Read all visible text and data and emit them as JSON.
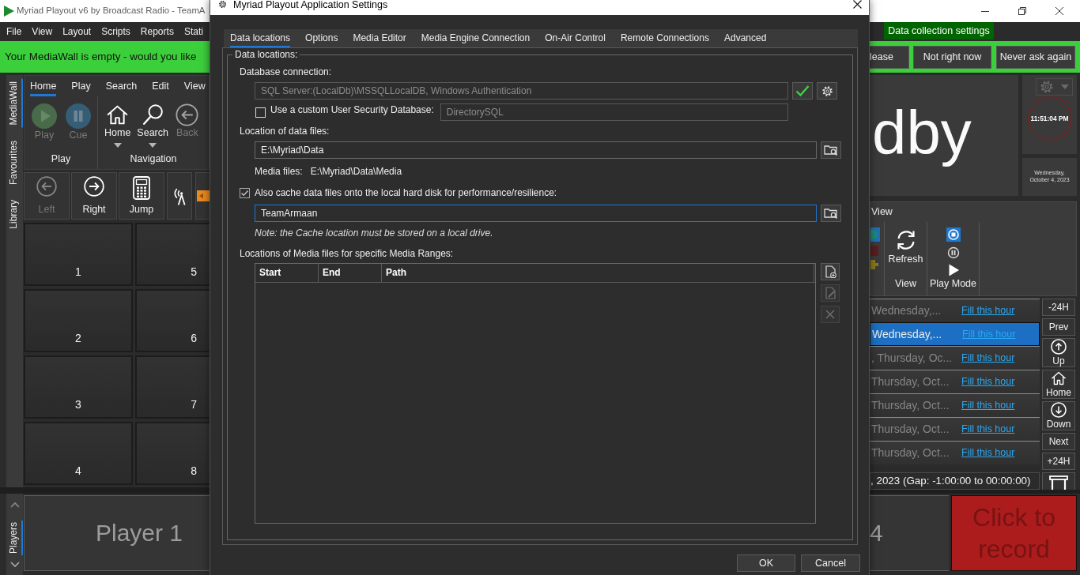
{
  "main_window": {
    "title": "Myriad Playout v6 by Broadcast Radio - TeamA",
    "menu": [
      "File",
      "View",
      "Layout",
      "Scripts",
      "Reports",
      "Stati"
    ],
    "data_collection_tab": "Data collection settings",
    "banner": {
      "message": "Your MediaWall is empty - would you like",
      "buttons": [
        "lease",
        "Not right now",
        "Never ask again"
      ]
    },
    "side_tabs": [
      {
        "label": "MediaWall",
        "selected": true
      },
      {
        "label": "Favourites",
        "selected": false
      },
      {
        "label": "Library",
        "selected": false
      }
    ],
    "ribbon": {
      "tabs": [
        {
          "label": "Home",
          "selected": true
        },
        {
          "label": "Play",
          "selected": false
        },
        {
          "label": "Search",
          "selected": false
        },
        {
          "label": "Edit",
          "selected": false
        },
        {
          "label": "View",
          "selected": false
        }
      ],
      "groups": [
        {
          "title": "Play",
          "buttons": [
            {
              "kind": "play",
              "label": "Play",
              "disabled": true,
              "dropdown": false
            },
            {
              "kind": "cue",
              "label": "Cue",
              "disabled": true,
              "dropdown": false
            }
          ]
        },
        {
          "title": "Navigation",
          "buttons": [
            {
              "kind": "home",
              "label": "Home",
              "disabled": false,
              "dropdown": true
            },
            {
              "kind": "search",
              "label": "Search",
              "disabled": false,
              "dropdown": true
            },
            {
              "kind": "back",
              "label": "Back",
              "disabled": true,
              "dropdown": false
            }
          ]
        }
      ]
    },
    "toolbar": [
      {
        "kind": "left",
        "label": "Left",
        "disabled": true
      },
      {
        "kind": "right",
        "label": "Right",
        "disabled": false
      },
      {
        "kind": "jump",
        "label": "Jump",
        "disabled": false
      },
      {
        "kind": "antenna",
        "disabled": false
      },
      {
        "kind": "marker",
        "disabled": false
      }
    ],
    "mediawall_tiles": [
      "1",
      "2",
      "3",
      "4",
      "5",
      "6",
      "7",
      "8"
    ],
    "players_tab": {
      "label": "Players",
      "selected": true
    },
    "player_labels": [
      "Player 1",
      "4"
    ],
    "standby_text": "dby",
    "clock": {
      "time": "11:51:04 PM",
      "date": "Wednesday, October 4, 2023"
    },
    "log_ribbon": {
      "tab": "View",
      "refresh": "Refresh",
      "group_labels": [
        "View",
        "Play Mode"
      ],
      "play_modes": [
        {
          "kind": "stop",
          "selected": true
        },
        {
          "kind": "pause",
          "selected": false
        },
        {
          "kind": "play",
          "selected": false
        }
      ]
    },
    "log_rows": [
      {
        "date": "Wednesday,...",
        "action": "Fill this hour",
        "selected": false
      },
      {
        "date": "Wednesday,...",
        "action": "Fill this hour",
        "selected": true
      },
      {
        "date": ", Thursday, Oc...",
        "action": "Fill this hour",
        "selected": false
      },
      {
        "date": "Thursday, Oct...",
        "action": "Fill this hour",
        "selected": false
      },
      {
        "date": "Thursday, Oct...",
        "action": "Fill this hour",
        "selected": false
      },
      {
        "date": "Thursday, Oct...",
        "action": "Fill this hour",
        "selected": false
      },
      {
        "date": "Thursday, Oct...",
        "action": "Fill this hour",
        "selected": false
      }
    ],
    "log_nav": [
      {
        "kind": "text",
        "label": "-24H"
      },
      {
        "kind": "text",
        "label": "Prev"
      },
      {
        "kind": "up",
        "label": "Up"
      },
      {
        "kind": "home",
        "label": "Home"
      },
      {
        "kind": "down",
        "label": "Down"
      },
      {
        "kind": "text",
        "label": "Next"
      },
      {
        "kind": "text",
        "label": "+24H"
      },
      {
        "kind": "stool"
      }
    ],
    "status": ", 2023 (Gap: -1:00:00 to 00:00:00)",
    "record_button": "Click to record"
  },
  "settings_dialog": {
    "title": "Myriad Playout Application Settings",
    "tabs": [
      {
        "label": "Data locations",
        "selected": true
      },
      {
        "label": "Options",
        "selected": false
      },
      {
        "label": "Media Editor",
        "selected": false
      },
      {
        "label": "Media Engine Connection",
        "selected": false
      },
      {
        "label": "On-Air Control",
        "selected": false
      },
      {
        "label": "Remote Connections",
        "selected": false
      },
      {
        "label": "Advanced",
        "selected": false
      }
    ],
    "group_title": "Data locations:",
    "database_connection": {
      "label": "Database connection:",
      "value": "SQL Server:(LocalDb)\\MSSQLLocalDB, Windows Authentication",
      "disabled": true,
      "verified": true
    },
    "custom_security_database": {
      "label": "Use a custom User Security Database:",
      "checked": false,
      "value": "DirectorySQL",
      "disabled": true
    },
    "data_files": {
      "label": "Location of data files:",
      "value": "E:\\Myriad\\Data",
      "focused": false
    },
    "media_files": {
      "label": "Media files:",
      "value": "E:\\Myriad\\Data\\Media"
    },
    "cache": {
      "label": "Also cache data files onto the local hard disk for performance/resilience:",
      "checked": true,
      "value": "TeamArmaan",
      "focused": true
    },
    "cache_note": "Note: the Cache location must be stored on a local drive.",
    "media_ranges": {
      "label": "Locations of Media files for specific Media Ranges:",
      "columns": [
        "Start",
        "End",
        "Path"
      ],
      "actions": [
        {
          "kind": "add",
          "disabled": false
        },
        {
          "kind": "edit",
          "disabled": true
        },
        {
          "kind": "remove",
          "disabled": true
        }
      ]
    },
    "buttons": [
      "OK",
      "Cancel"
    ]
  }
}
